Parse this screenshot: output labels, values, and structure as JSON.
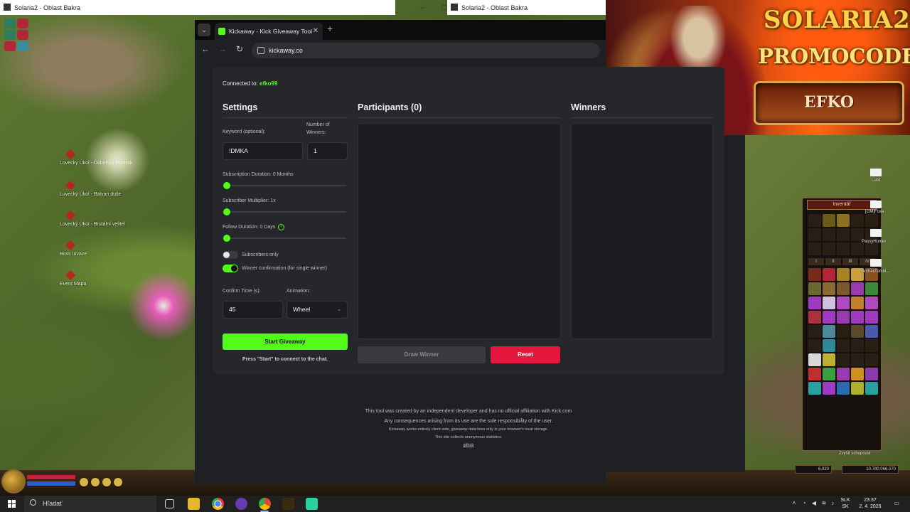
{
  "game": {
    "window_title_1": "Solaria2 - Oblast Bakra",
    "window_title_2": "Solaria2 - Oblast Bakra",
    "npcs": [
      "Lovecký Úkol - Ďábelský Mortrak",
      "Lovecký Úkol - Balvan duše",
      "Lovecký Úkol - Brutální velitel",
      "Boss Invaze",
      "Event Mapa"
    ],
    "inventory_title": "Inventář",
    "inventory_tabs": [
      "I",
      "II",
      "III",
      "IV"
    ],
    "gm_label_1": "[GM]Foxe",
    "gm_label_2": "PassyHunter",
    "gm_label_3": "ArcherZombi...",
    "mail_label": "Lub1",
    "skill_label": "Zvyšit schopnost",
    "gold_small": "6.020",
    "gold_big": "10.780.066.070"
  },
  "promo": {
    "logo": "SOLARIA2",
    "title": "PROMOCODE",
    "code": "EFKO"
  },
  "browser": {
    "tab_title": "Kickaway - Kick Giveaway Tool",
    "url": "kickaway.co"
  },
  "app": {
    "connected_label": "Connected to:",
    "connected_user": "efko99",
    "settings_title": "Settings",
    "keyword_label": "Keyword (optional):",
    "keyword_value": "!DMKA",
    "winners_label": "Number of Winners:",
    "winners_value": "1",
    "sub_duration_label": "Subscription Duration: 0 Months",
    "sub_multiplier_label": "Subscriber Multiplier: 1x",
    "follow_duration_label": "Follow Duration:  0  Days",
    "subs_only_label": "Subscribers only",
    "winner_confirm_label": "Winner confirmation (for single winner)",
    "confirm_time_label": "Confirm Time (s):",
    "confirm_time_value": "45",
    "animation_label": "Animation:",
    "animation_value": "Wheel",
    "start_button": "Start Giveaway",
    "start_hint": "Press \"Start\" to connect to the chat.",
    "participants_title": "Participants (0)",
    "winners_title": "Winners",
    "draw_button": "Draw Winner",
    "reset_button": "Reset",
    "subs_only_on": false,
    "winner_confirm_on": true,
    "sub_duration_value": 0,
    "sub_multiplier_value": 1,
    "follow_duration_value": 0
  },
  "footer": {
    "line1": "This tool was created by an independent developer and has no official affiliation with Kick.com",
    "line2": "Any consequences arising from its use are the sole responsibility of the user.",
    "line3": "Kickaway works entirely client-side, giveaway data lives only in your browser's local storage.",
    "line4": "This site collects anonymous statistics.",
    "link": "github"
  },
  "taskbar": {
    "search_placeholder": "Hľadať",
    "lang_1": "SLK",
    "lang_2": "SK",
    "time": "23:37",
    "date": "2. 4. 2026"
  }
}
